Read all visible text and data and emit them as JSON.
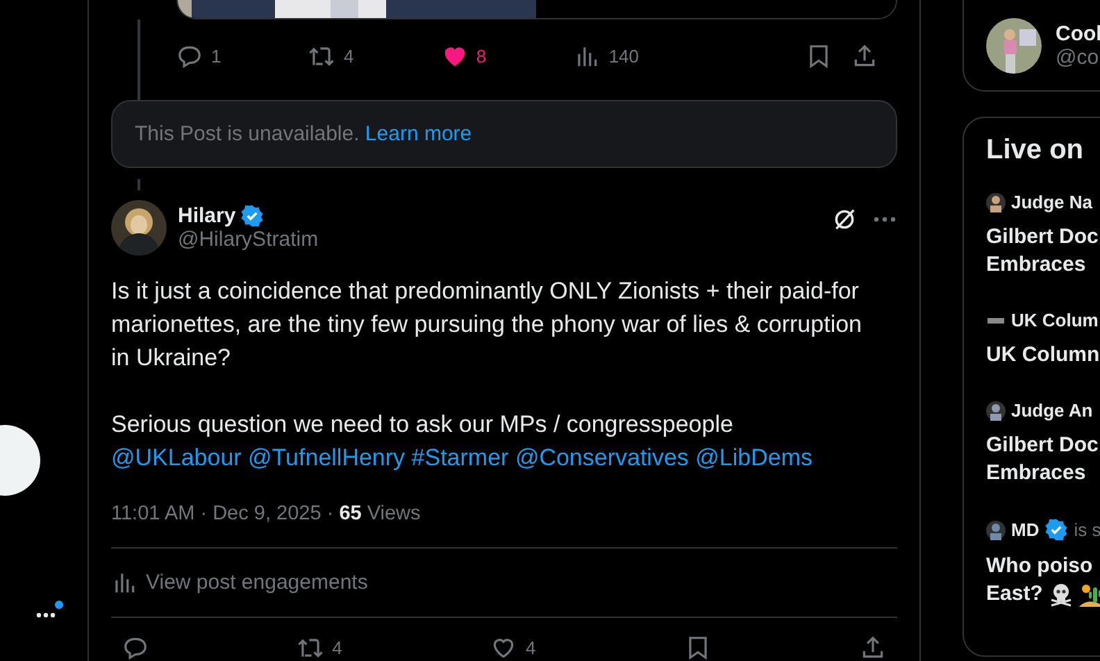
{
  "nav": {
    "notification_dot": true
  },
  "parent_post": {
    "actions": [
      {
        "kind": "reply",
        "count": "1",
        "active": false
      },
      {
        "kind": "repost",
        "count": "4",
        "active": false
      },
      {
        "kind": "like",
        "count": "8",
        "active": true
      },
      {
        "kind": "views",
        "count": "140",
        "active": false
      },
      {
        "kind": "bookmark",
        "active": false
      },
      {
        "kind": "share",
        "active": false
      }
    ]
  },
  "unavailable_notice": {
    "text": "This Post is unavailable.",
    "link": "Learn more"
  },
  "post": {
    "name": "Hilary",
    "verified": true,
    "handle": "@HilaryStratim",
    "paragraphs": [
      [
        {
          "kind": "text",
          "text": "Is it just a coincidence that predominantly ONLY Zionists + their paid-for marionettes, are the tiny few pursuing the phony war of lies & corruption in Ukraine?"
        }
      ],
      [
        {
          "kind": "text",
          "text": "Serious question we need to ask our MPs / congresspeople"
        },
        {
          "kind": "link",
          "text": "@UKLabour"
        },
        {
          "kind": "link",
          "text": "@TufnellHenry"
        },
        {
          "kind": "link",
          "text": "#Starmer"
        },
        {
          "kind": "link",
          "text": "@Conservatives"
        },
        {
          "kind": "link",
          "text": "@LibDems"
        }
      ]
    ],
    "time": "11:01 AM · Dec 9, 2025",
    "separator": "·",
    "views_count": "65",
    "views_label": "Views",
    "engagements": "View post engagements",
    "actions": [
      {
        "kind": "reply",
        "active": false
      },
      {
        "kind": "repost",
        "count": "4",
        "active": false
      },
      {
        "kind": "like",
        "count": "4",
        "active": false
      },
      {
        "kind": "bookmark",
        "active": false
      },
      {
        "kind": "share",
        "active": false
      }
    ]
  },
  "sidebar": {
    "follow_card": {
      "name": "Cool",
      "handle": "@co"
    },
    "live": {
      "title": "Live on",
      "items": [
        {
          "host": "Judge Na",
          "headline": [
            "Gilbert Doc",
            "Embraces"
          ],
          "verified": false
        },
        {
          "host": "UK Colum",
          "headline": [
            "UK Column"
          ],
          "verified": false
        },
        {
          "host": "Judge An",
          "headline": [
            "Gilbert Doc",
            "Embraces"
          ],
          "verified": false
        },
        {
          "host": "MD",
          "note": "is s",
          "headline": [
            "Who poiso",
            "East?"
          ],
          "verified": true
        }
      ]
    }
  }
}
